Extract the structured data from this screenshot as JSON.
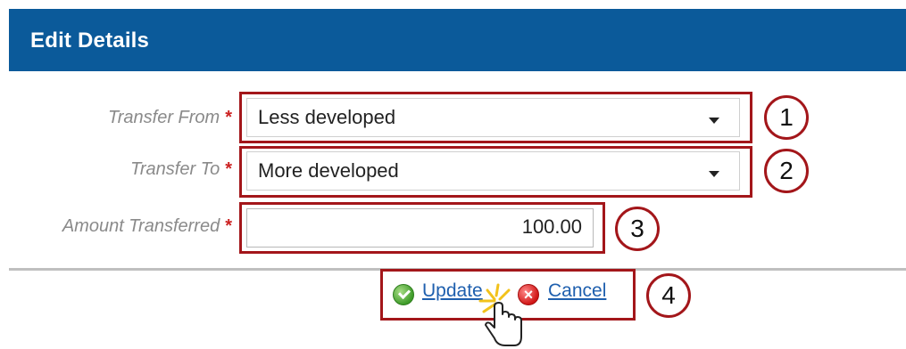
{
  "dialog": {
    "title": "Edit Details"
  },
  "form": {
    "transfer_from": {
      "label": "Transfer From",
      "value": "Less developed"
    },
    "transfer_to": {
      "label": "Transfer To",
      "value": "More developed"
    },
    "amount_transferred": {
      "label": "Amount Transferred",
      "value": "100.00"
    },
    "required_marker": "*"
  },
  "actions": {
    "update_label": "Update",
    "cancel_label": "Cancel"
  },
  "callouts": [
    "1",
    "2",
    "3",
    "4"
  ],
  "icons": {
    "update": "check-circle-icon",
    "cancel": "x-circle-icon",
    "cursor": "hand-pointer-icon"
  },
  "colors": {
    "header": "#0b5a9a",
    "highlight": "#a3161a",
    "link": "#1e5fae",
    "required": "#cc2222"
  }
}
